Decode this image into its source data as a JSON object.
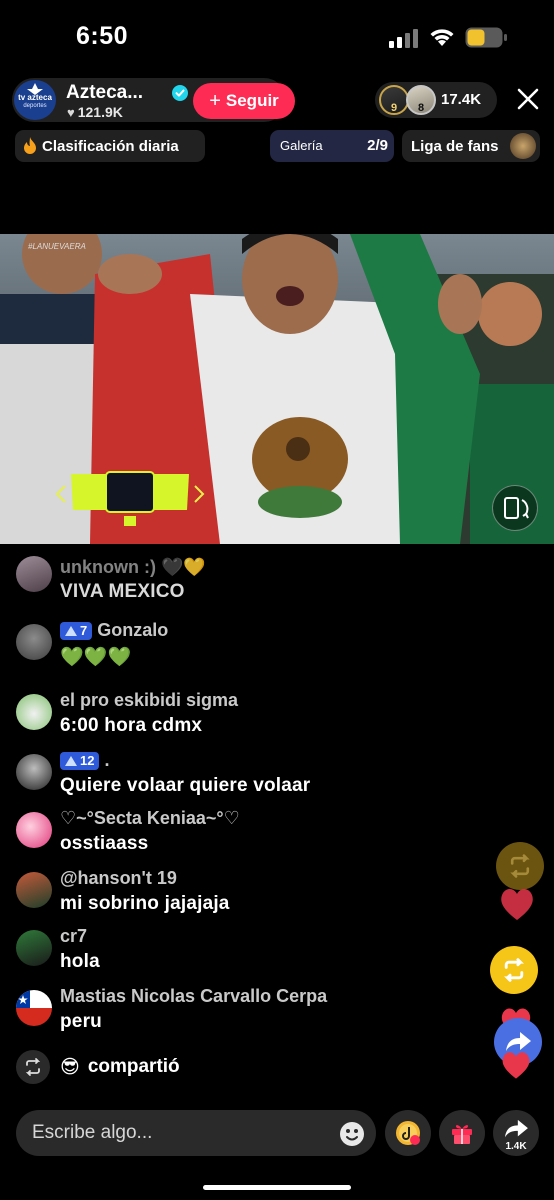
{
  "status_bar": {
    "time": "6:50"
  },
  "header": {
    "channel_name": "Azteca...",
    "channel_logo_text": "tv azteca",
    "channel_logo_sub": "deportes",
    "likes": "121.9K",
    "follow_label": "Seguir",
    "viewer_ranks": [
      "9",
      "8"
    ],
    "viewer_count": "17.4K",
    "ranking_label": "Clasificación diaria",
    "gallery_label": "Galería",
    "gallery_count": "2/9",
    "fans_label": "Liga de fans"
  },
  "video": {
    "watermark": "#LANUEVAERA"
  },
  "comments": [
    {
      "user": "unknown :)",
      "user_suffix": "🖤💛",
      "message": "VIVA  MEXICO",
      "level": ""
    },
    {
      "user": "Gonzalo",
      "user_suffix": "",
      "message": "💚💚💚",
      "level": "7"
    },
    {
      "user": "el pro eskibidi sigma",
      "user_suffix": "",
      "message": "6:00 hora cdmx",
      "level": ""
    },
    {
      "user": ".",
      "user_suffix": "",
      "message": "Quiere volaar quiere volaar",
      "level": "12"
    },
    {
      "user": "♡~°Secta Keniaa~°♡",
      "user_suffix": "",
      "message": "osstiaass",
      "level": ""
    },
    {
      "user": "@hanson't 19",
      "user_suffix": "",
      "message": "mi sobrino jajajaja",
      "level": ""
    },
    {
      "user": "cr7",
      "user_suffix": "",
      "message": "hola",
      "level": ""
    },
    {
      "user": "Mastias Nicolas Carvallo Cerpa",
      "user_suffix": "",
      "message": "peru",
      "level": ""
    }
  ],
  "share_event": {
    "emoji": "😎",
    "text": "compartió"
  },
  "bottom_bar": {
    "comment_placeholder": "Escribe algo...",
    "share_count": "1.4K"
  },
  "colors": {
    "follow": "#fe2c55",
    "level_badge": "#2f5bdb",
    "repost_yellow": "#f5c518",
    "like_red": "#e8364b"
  }
}
